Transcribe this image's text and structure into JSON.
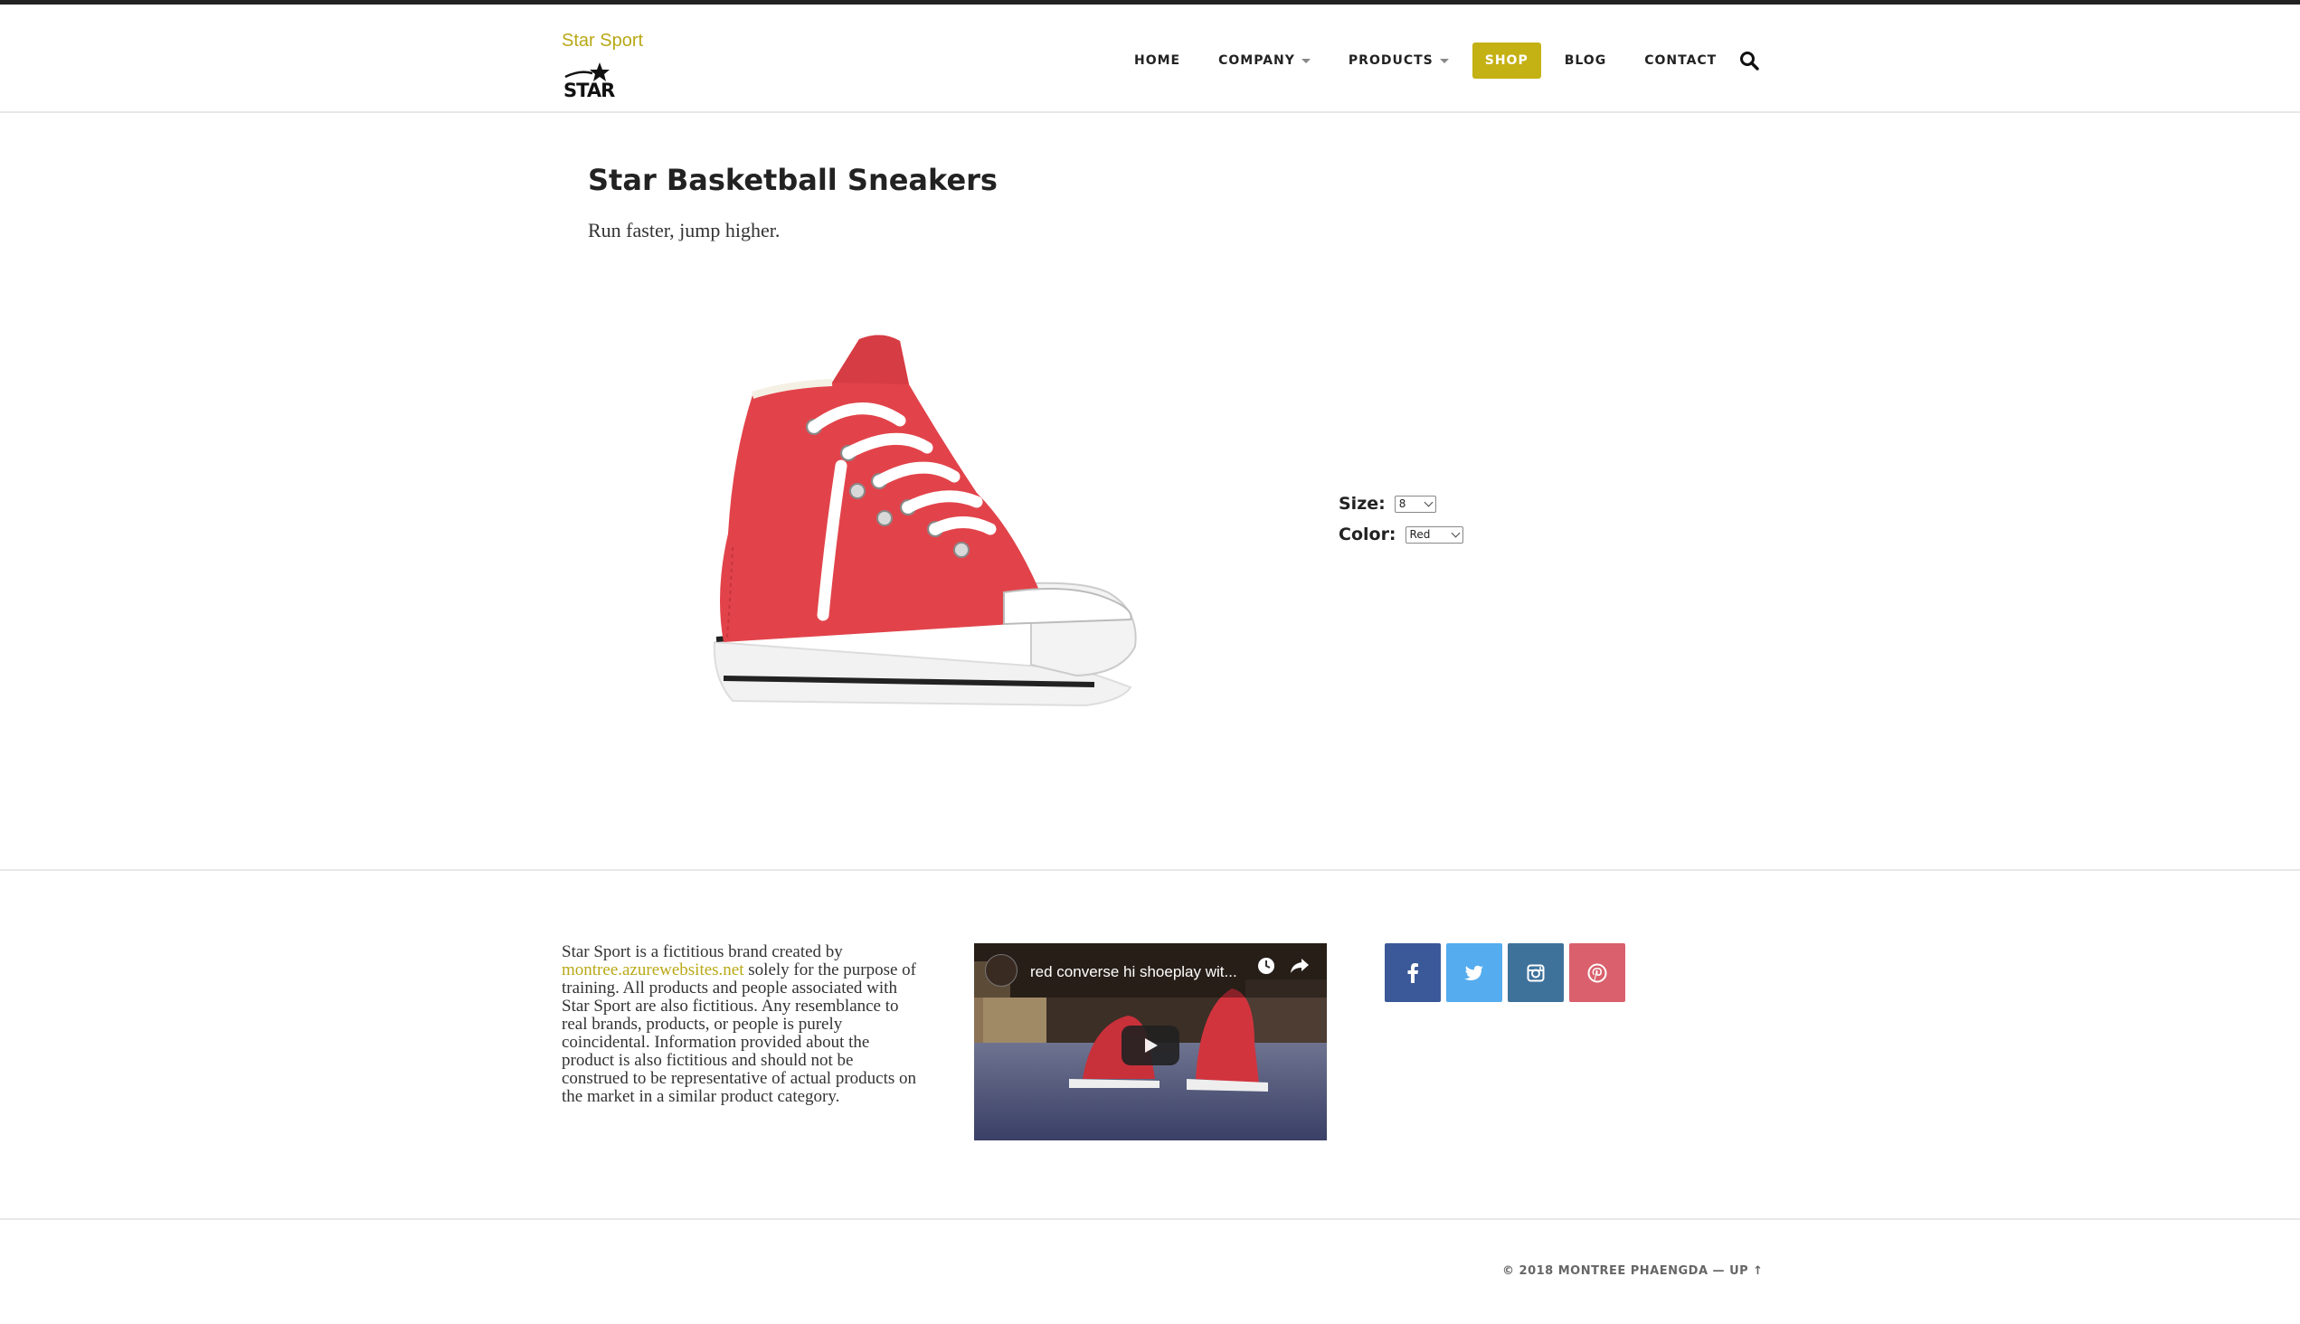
{
  "brand": {
    "name": "Star Sport",
    "logo_text": "STAR"
  },
  "nav": {
    "items": [
      {
        "label": "HOME"
      },
      {
        "label": "COMPANY"
      },
      {
        "label": "PRODUCTS"
      },
      {
        "label": "SHOP"
      },
      {
        "label": "BLOG"
      },
      {
        "label": "CONTACT"
      }
    ],
    "active": "SHOP",
    "search_icon": "search-icon"
  },
  "product": {
    "title": "Star Basketball Sneakers",
    "tagline": "Run faster, jump higher.",
    "image": "red-high-top-sneaker",
    "size_label": "Size:",
    "size_value": "8",
    "color_label": "Color:",
    "color_value": "Red"
  },
  "footer": {
    "text_before": "Star Sport is a fictitious brand created by ",
    "link": "montree.azurewebsites.net",
    "text_after": " solely for the purpose of training. All products and people associated with Star Sport are also fictitious. Any resemblance to real brands, products, or people is purely coincidental. Information provided about the product is also fictitious and should not be construed to be representative of actual products on the market in a similar product category.",
    "video_title": "red converse hi shoeplay wit...",
    "social": [
      "facebook-icon",
      "twitter-icon",
      "instagram-icon",
      "pinterest-icon"
    ],
    "copyright": "© 2018 MONTREE PHAENGDA — UP ↑"
  },
  "colors": {
    "accent": "#c4b114",
    "facebook": "#3b5998",
    "twitter": "#55acee",
    "instagram": "#3f729b",
    "pinterest": "#d9606c",
    "shoe_red": "#e2434a"
  }
}
